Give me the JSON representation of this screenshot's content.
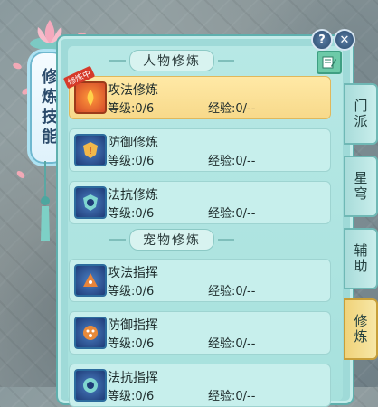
{
  "window": {
    "title": "修炼技能",
    "help_label": "?",
    "close_label": "✕",
    "edit_icon": "note-edit-icon"
  },
  "sections": [
    {
      "title": "人物修炼",
      "items": [
        {
          "name": "攻法修炼",
          "level_label": "等级:0/6",
          "exp_label": "经验:0/--",
          "icon": "attack-cultivation-icon",
          "selected": true,
          "badge": "修炼中"
        },
        {
          "name": "防御修炼",
          "level_label": "等级:0/6",
          "exp_label": "经验:0/--",
          "icon": "defense-cultivation-icon",
          "selected": false
        },
        {
          "name": "法抗修炼",
          "level_label": "等级:0/6",
          "exp_label": "经验:0/--",
          "icon": "magic-resist-cultivation-icon",
          "selected": false
        }
      ]
    },
    {
      "title": "宠物修炼",
      "items": [
        {
          "name": "攻法指挥",
          "level_label": "等级:0/6",
          "exp_label": "经验:0/--",
          "icon": "pet-attack-command-icon",
          "selected": false
        },
        {
          "name": "防御指挥",
          "level_label": "等级:0/6",
          "exp_label": "经验:0/--",
          "icon": "pet-defense-command-icon",
          "selected": false
        },
        {
          "name": "法抗指挥",
          "level_label": "等级:0/6",
          "exp_label": "经验:0/--",
          "icon": "pet-magic-resist-command-icon",
          "selected": false
        }
      ]
    }
  ],
  "tabs": [
    {
      "label": "门派",
      "active": false
    },
    {
      "label": "星穹",
      "active": false
    },
    {
      "label": "辅助",
      "active": false
    },
    {
      "label": "修炼",
      "active": true
    }
  ],
  "colors": {
    "panel_bg": "#9fdad8",
    "selected_row": "#f7d98a",
    "tab_active": "#f0d37a"
  }
}
